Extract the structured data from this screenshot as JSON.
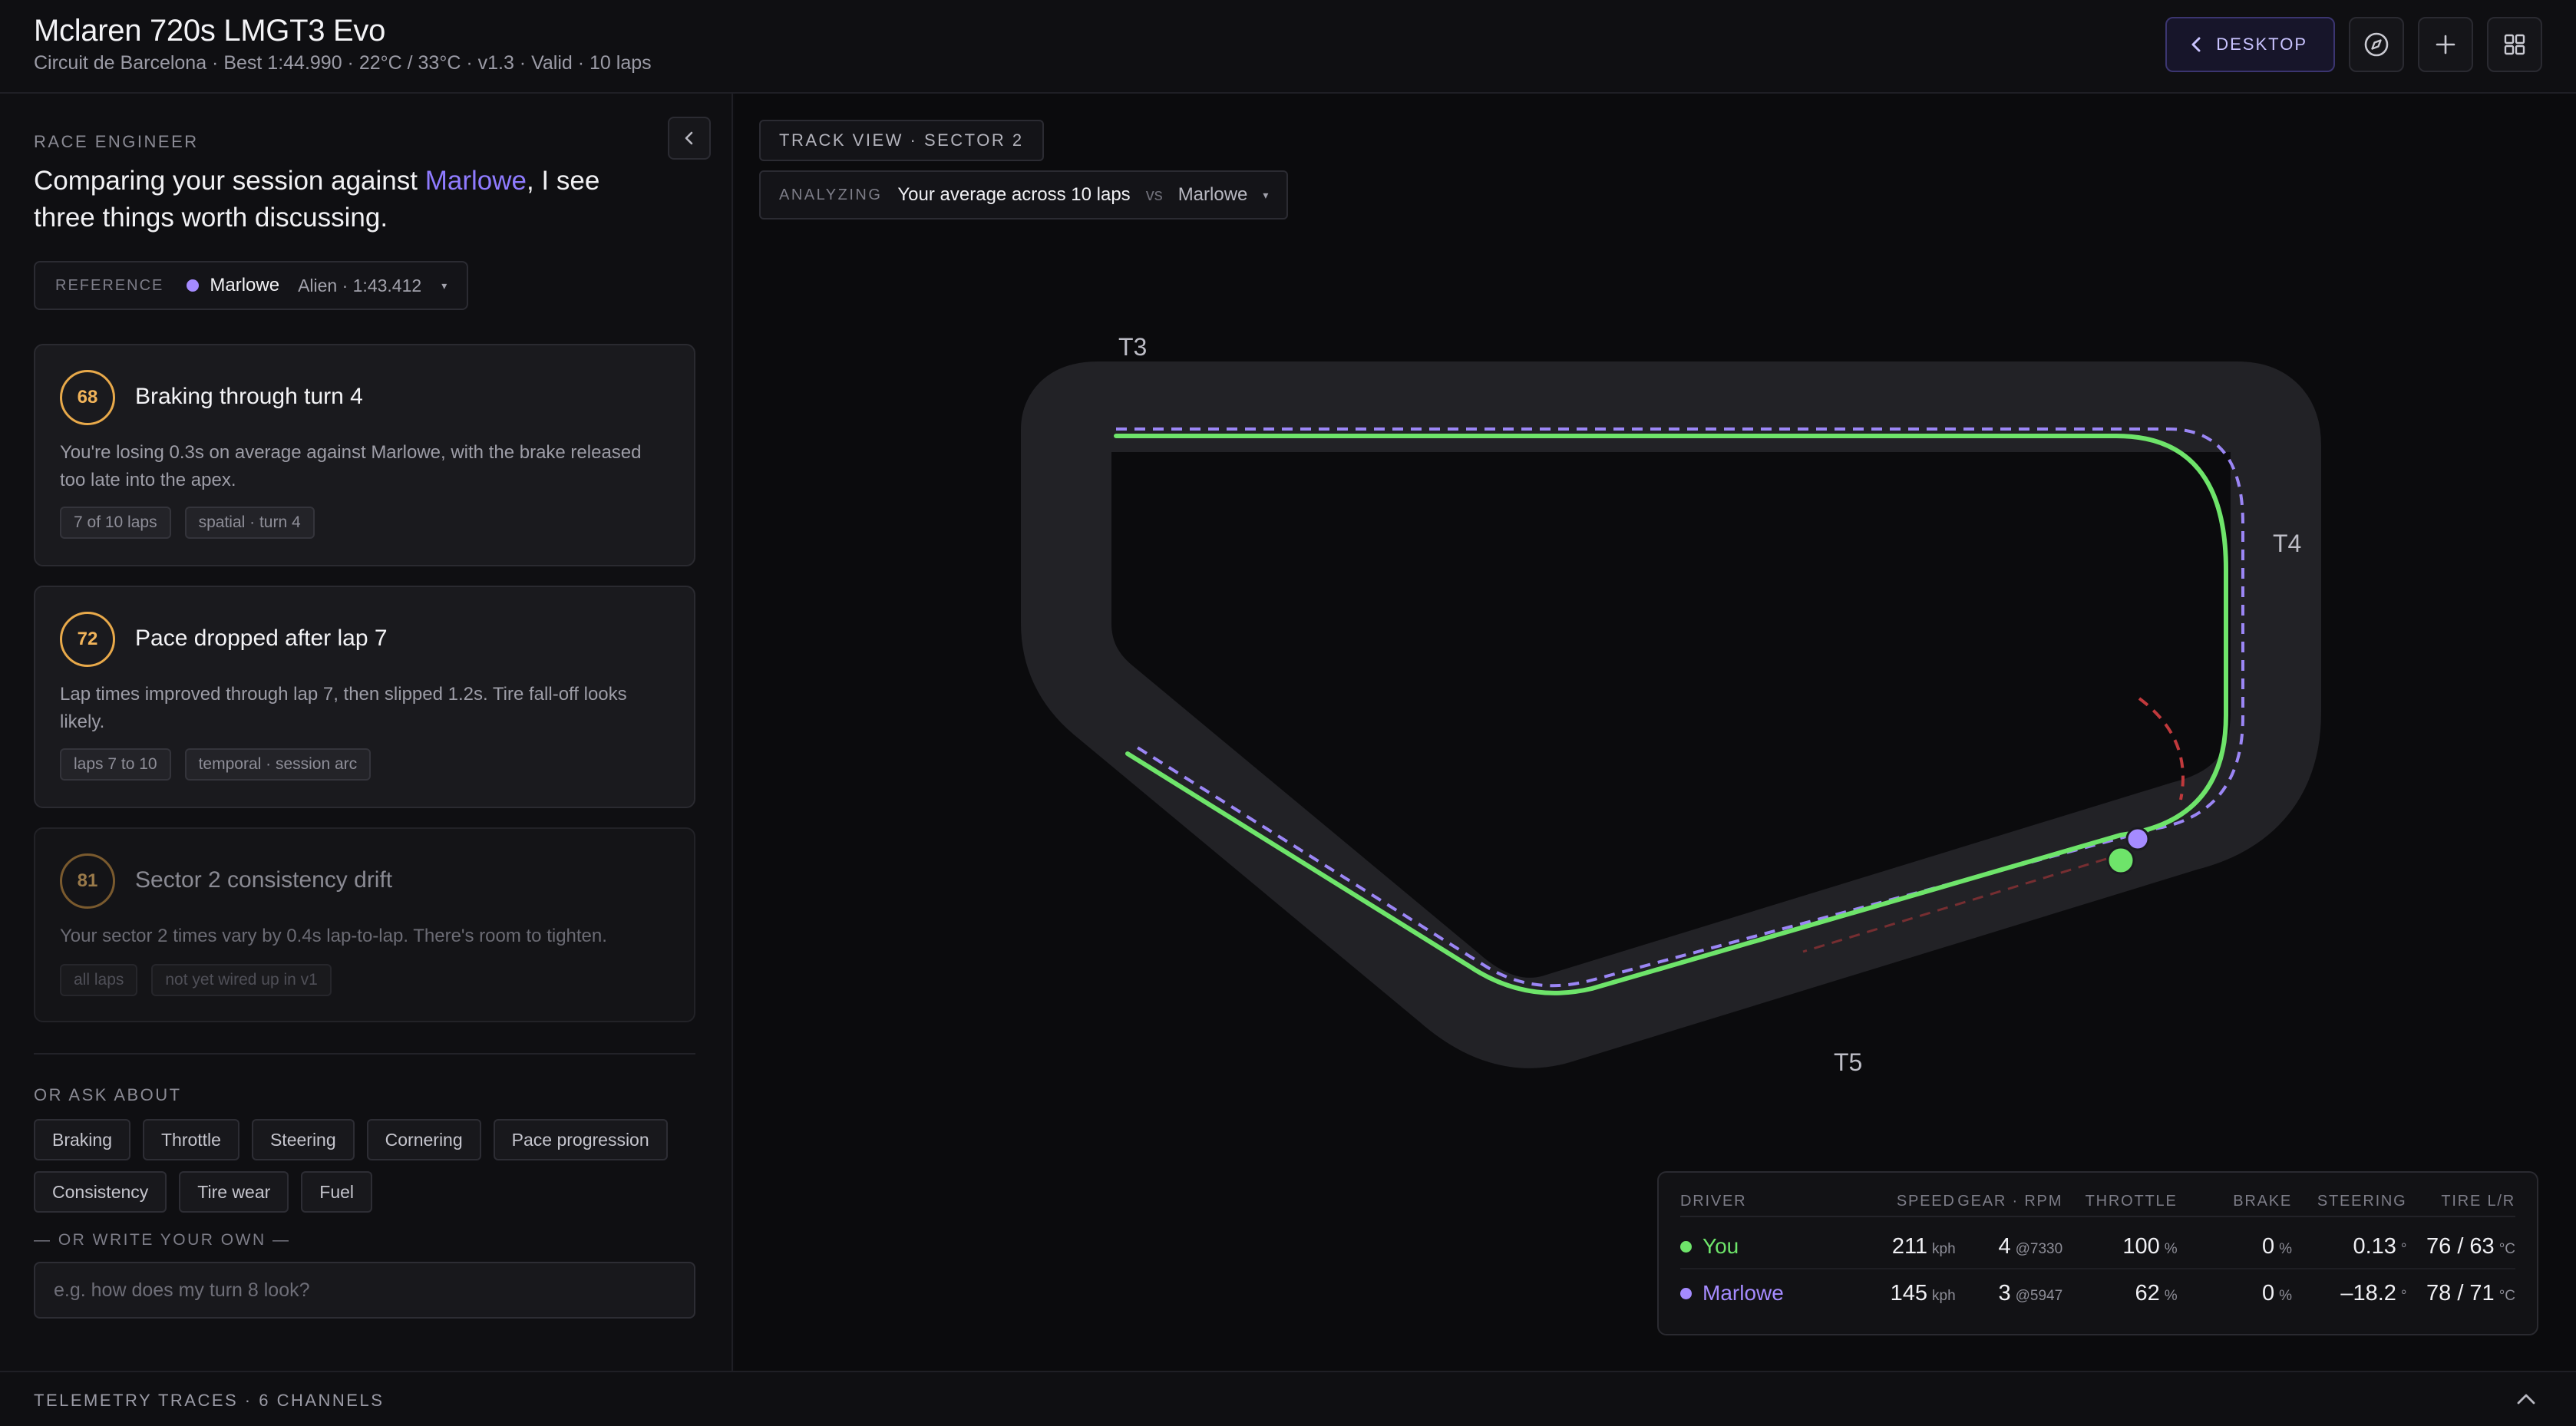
{
  "header": {
    "title": "Mclaren 720s LMGT3 Evo",
    "subtitle": "Circuit de Barcelona · Best 1:44.990 · 22°C / 33°C · v1.3 · Valid · 10 laps",
    "desktop_label": "DESKTOP",
    "icons": [
      "chevron-left-icon",
      "compass-icon",
      "plus-icon",
      "grid-icon"
    ]
  },
  "engineer": {
    "label": "RACE ENGINEER",
    "intro_before": "Comparing your session against ",
    "intro_highlight": "Marlowe",
    "intro_after": ", I see three things worth discussing.",
    "reference": {
      "label": "REFERENCE",
      "name": "Marlowe",
      "meta": "Alien · 1:43.412"
    },
    "insights": [
      {
        "score": "68",
        "title": "Braking through turn 4",
        "body": "You're losing 0.3s on average against Marlowe, with the brake released too late into the apex.",
        "tags": [
          "7 of 10 laps",
          "spatial · turn 4"
        ]
      },
      {
        "score": "72",
        "title": "Pace dropped after lap 7",
        "body": "Lap times improved through lap 7, then slipped 1.2s. Tire fall-off looks likely.",
        "tags": [
          "laps 7 to 10",
          "temporal · session arc"
        ]
      },
      {
        "score": "81",
        "title": "Sector 2 consistency drift",
        "body": "Your sector 2 times vary by 0.4s lap-to-lap. There's room to tighten.",
        "tags": [
          "all laps",
          "not yet wired up in v1"
        ]
      }
    ],
    "ask_label": "OR ASK ABOUT",
    "chips": [
      "Braking",
      "Throttle",
      "Steering",
      "Cornering",
      "Pace progression",
      "Consistency",
      "Tire wear",
      "Fuel"
    ],
    "write_label": "— OR WRITE YOUR OWN —",
    "input_placeholder": "e.g. how does my turn 8 look?",
    "input_value": ""
  },
  "track": {
    "view_label": "TRACK VIEW · SECTOR 2",
    "analyzing_label": "ANALYZING",
    "analyzing_you": "Your average across 10 laps",
    "analyzing_vs": "vs",
    "analyzing_ref": "Marlowe",
    "turns": [
      "T3",
      "T4",
      "T5"
    ],
    "colors": {
      "you": "#6ee46a",
      "reference": "#9b86f5",
      "brake": "#c0393c",
      "asphalt": "#222226"
    }
  },
  "telemetry": {
    "headers": [
      "DRIVER",
      "SPEED",
      "GEAR · RPM",
      "THROTTLE",
      "BRAKE",
      "STEERING",
      "TIRE L/R"
    ],
    "rows": [
      {
        "driver": "You",
        "color": "#6ee46a",
        "speed": "211",
        "speed_unit": "kph",
        "gear": "4",
        "rpm": "@7330",
        "throttle": "100",
        "throttle_unit": "%",
        "brake": "0",
        "brake_unit": "%",
        "steering": "0.13",
        "steering_unit": "°",
        "tire": "76 / 63",
        "tire_unit": "°C"
      },
      {
        "driver": "Marlowe",
        "color": "#a58bff",
        "speed": "145",
        "speed_unit": "kph",
        "gear": "3",
        "rpm": "@5947",
        "throttle": "62",
        "throttle_unit": "%",
        "brake": "0",
        "brake_unit": "%",
        "steering": "–18.2",
        "steering_unit": "°",
        "tire": "78 / 71",
        "tire_unit": "°C"
      }
    ]
  },
  "bottom": {
    "label": "TELEMETRY TRACES · 6 CHANNELS"
  }
}
